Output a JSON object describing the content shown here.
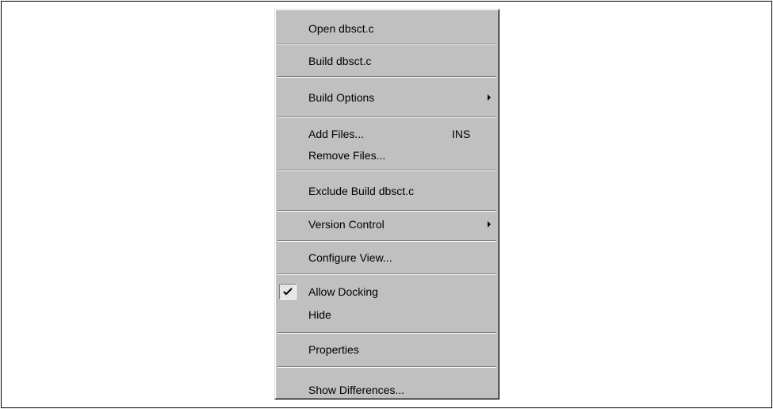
{
  "context_menu": {
    "open": "Open dbsct.c",
    "build": "Build dbsct.c",
    "build_options": "Build Options",
    "add_files": "Add Files...",
    "add_files_shortcut": "INS",
    "remove_files": "Remove Files...",
    "exclude_build": "Exclude Build dbsct.c",
    "version_control": "Version Control",
    "configure_view": "Configure View...",
    "allow_docking": "Allow Docking",
    "allow_docking_checked": true,
    "hide": "Hide",
    "properties": "Properties",
    "show_differences": "Show Differences..."
  }
}
